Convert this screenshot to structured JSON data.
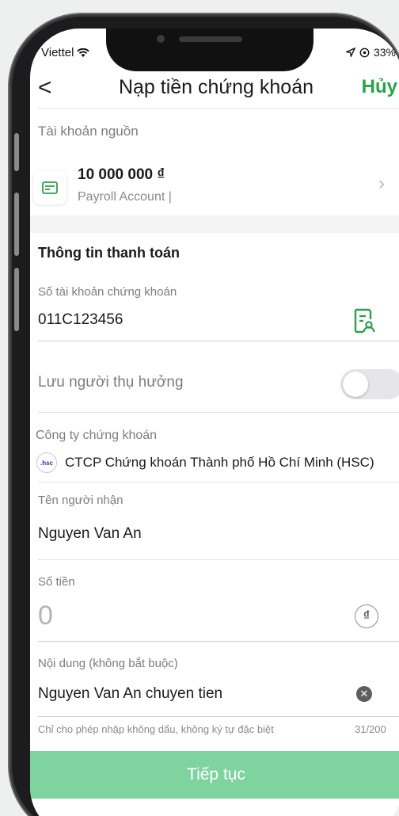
{
  "status": {
    "carrier": "Viettel",
    "battery": "33%"
  },
  "nav": {
    "back": "<",
    "title": "Nạp tiền chứng khoán",
    "cancel": "Hủy"
  },
  "source": {
    "section_label": "Tài khoản nguồn",
    "amount": "10 000 000 ₫",
    "account_name": "Payroll Account |"
  },
  "payment": {
    "section_title": "Thông tin thanh toán",
    "account_label": "Số tài khoản chứng khoán",
    "account_value": "011C123456",
    "save_beneficiary_label": "Lưu người thụ hưởng",
    "save_beneficiary_on": false,
    "company_label": "Công ty chứng khoán",
    "company_logo_text": ".hsc",
    "company_value": "CTCP Chứng khoán Thành phố Hồ Chí Minh (HSC)",
    "recipient_label": "Tên người nhận",
    "recipient_value": "Nguyen Van An",
    "amount_label": "Số tiền",
    "amount_value": "0",
    "currency_symbol": "₫",
    "content_label": "Nội dung (không bắt buộc)",
    "content_value": "Nguyen Van An chuyen tien",
    "content_hint": "Chỉ cho phép nhập không dấu, không ký tự đặc biệt",
    "content_counter": "31/200"
  },
  "actions": {
    "continue": "Tiếp tục"
  },
  "colors": {
    "accent": "#27a348",
    "button": "#7fd39e",
    "icon_green": "#2f9e4f"
  }
}
